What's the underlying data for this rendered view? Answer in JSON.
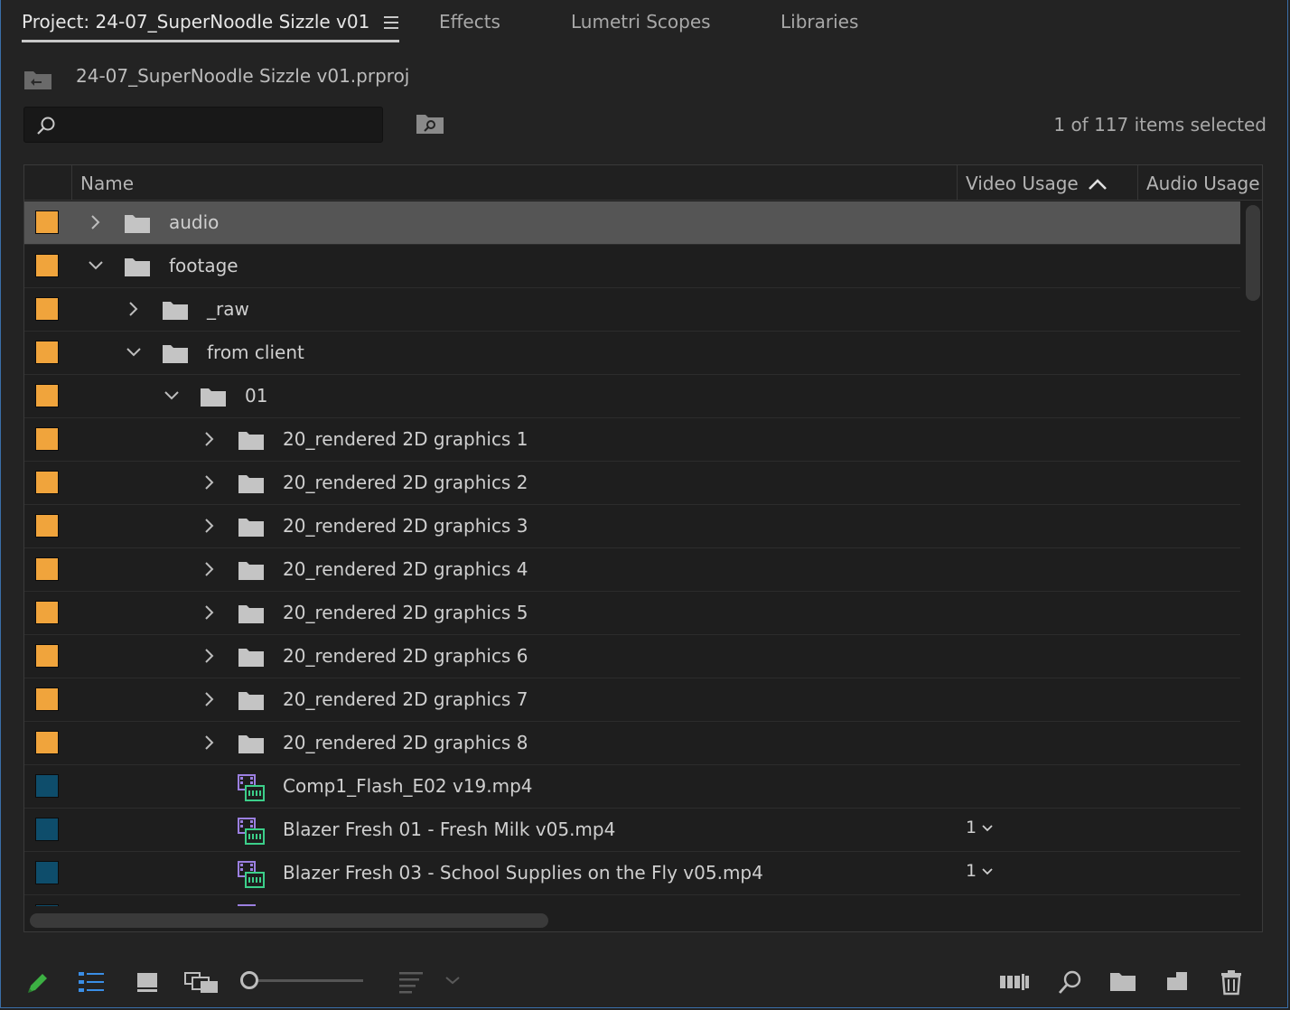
{
  "tabs": [
    {
      "label": "Project: 24-07_SuperNoodle Sizzle v01",
      "active": true
    },
    {
      "label": "Effects",
      "active": false
    },
    {
      "label": "Lumetri Scopes",
      "active": false
    },
    {
      "label": "Libraries",
      "active": false
    }
  ],
  "project": {
    "filename": "24-07_SuperNoodle Sizzle v01.prproj",
    "search_value": "",
    "selection_status": "1 of 117 items selected"
  },
  "columns": {
    "name": "Name",
    "video_usage": "Video Usage",
    "audio_usage": "Audio Usage",
    "sorted_by": "Video Usage",
    "sort_direction": "ascending"
  },
  "colors": {
    "bin_label": "#F0A43C",
    "clip_label": "#0E4D6B",
    "selected_row": "#555555",
    "accent_blue": "#3a8ee6",
    "pencil_green": "#3cb043"
  },
  "rows": [
    {
      "type": "bin",
      "name": "audio",
      "depth": 0,
      "expanded": false,
      "selected": true,
      "video_usage": ""
    },
    {
      "type": "bin",
      "name": "footage",
      "depth": 0,
      "expanded": true,
      "selected": false,
      "video_usage": ""
    },
    {
      "type": "bin",
      "name": "_raw",
      "depth": 1,
      "expanded": false,
      "selected": false,
      "video_usage": ""
    },
    {
      "type": "bin",
      "name": "from client",
      "depth": 1,
      "expanded": true,
      "selected": false,
      "video_usage": ""
    },
    {
      "type": "bin",
      "name": "01",
      "depth": 2,
      "expanded": true,
      "selected": false,
      "video_usage": ""
    },
    {
      "type": "bin",
      "name": "20_rendered 2D graphics 1",
      "depth": 3,
      "expanded": false,
      "selected": false,
      "video_usage": ""
    },
    {
      "type": "bin",
      "name": "20_rendered 2D graphics 2",
      "depth": 3,
      "expanded": false,
      "selected": false,
      "video_usage": ""
    },
    {
      "type": "bin",
      "name": "20_rendered 2D graphics 3",
      "depth": 3,
      "expanded": false,
      "selected": false,
      "video_usage": ""
    },
    {
      "type": "bin",
      "name": "20_rendered 2D graphics 4",
      "depth": 3,
      "expanded": false,
      "selected": false,
      "video_usage": ""
    },
    {
      "type": "bin",
      "name": "20_rendered 2D graphics 5",
      "depth": 3,
      "expanded": false,
      "selected": false,
      "video_usage": ""
    },
    {
      "type": "bin",
      "name": "20_rendered 2D graphics 6",
      "depth": 3,
      "expanded": false,
      "selected": false,
      "video_usage": ""
    },
    {
      "type": "bin",
      "name": "20_rendered 2D graphics 7",
      "depth": 3,
      "expanded": false,
      "selected": false,
      "video_usage": ""
    },
    {
      "type": "bin",
      "name": "20_rendered 2D graphics 8",
      "depth": 3,
      "expanded": false,
      "selected": false,
      "video_usage": ""
    },
    {
      "type": "clip",
      "name": "Comp1_Flash_E02 v19.mp4",
      "depth": 3,
      "selected": false,
      "video_usage": ""
    },
    {
      "type": "clip",
      "name": "Blazer Fresh 01 - Fresh Milk v05.mp4",
      "depth": 3,
      "selected": false,
      "video_usage": "1"
    },
    {
      "type": "clip",
      "name": "Blazer Fresh 03 - School Supplies on the Fly v05.mp4",
      "depth": 3,
      "selected": false,
      "video_usage": "1"
    },
    {
      "type": "clip",
      "name": "",
      "depth": 3,
      "selected": false,
      "video_usage": ""
    }
  ],
  "toolbar": {
    "icons": [
      "pencil-icon",
      "list-view-icon",
      "icon-view-icon",
      "freeform-view-icon",
      "zoom-slider",
      "sort-icons-icon",
      "automate-to-sequence-icon",
      "find-icon",
      "new-bin-icon",
      "new-item-icon",
      "trash-icon"
    ],
    "zoom_level": 0.0
  }
}
